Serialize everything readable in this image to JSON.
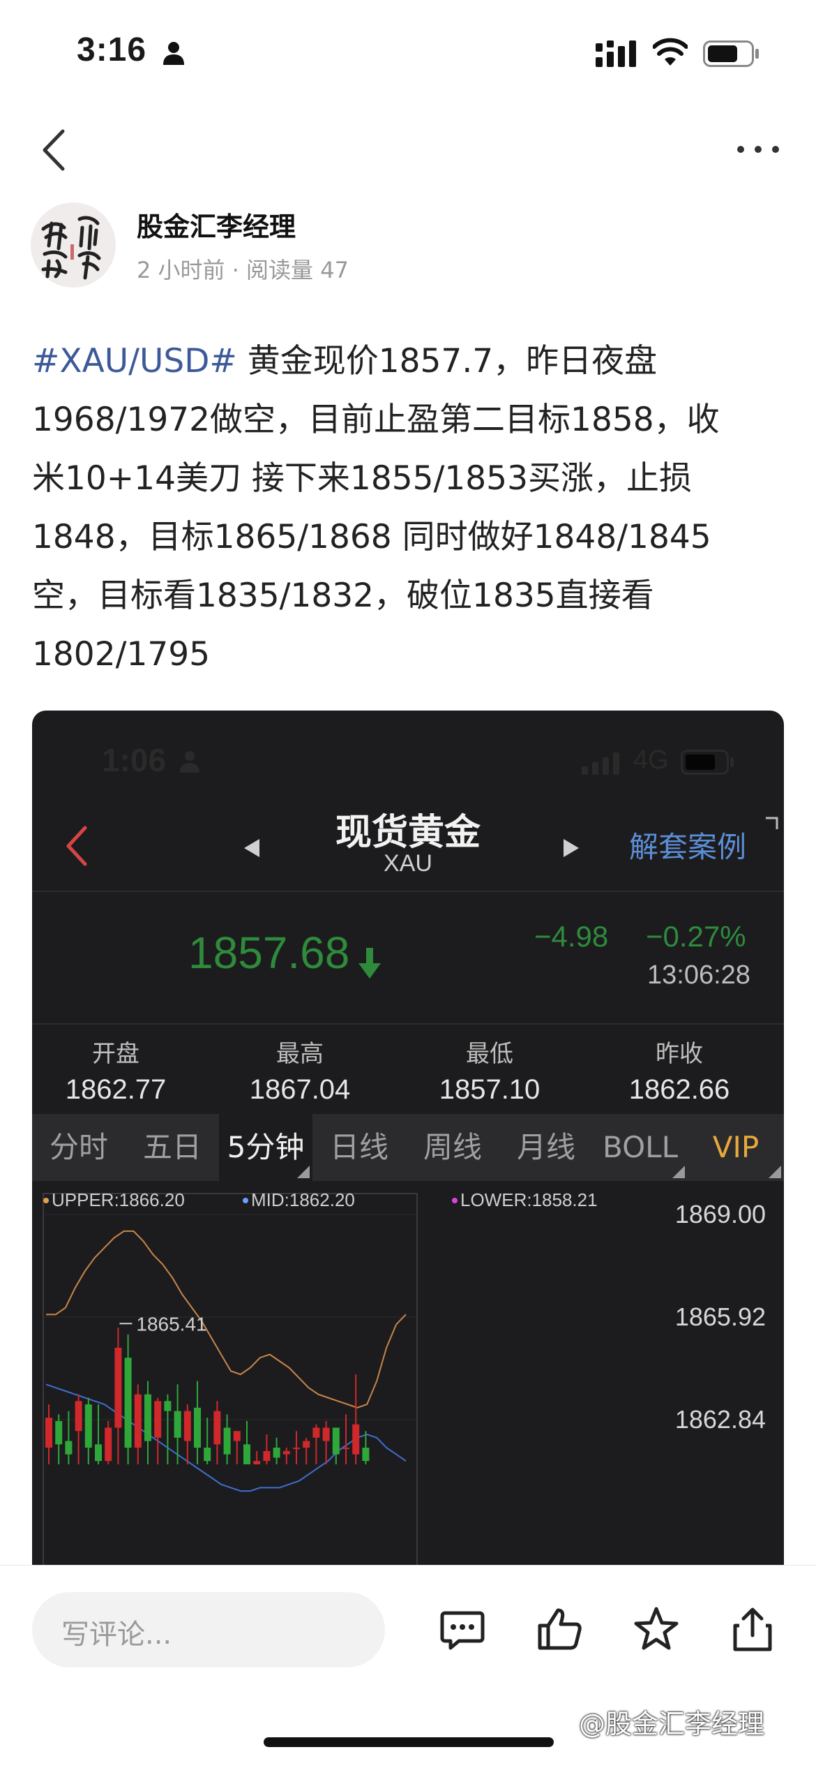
{
  "status_bar": {
    "time": "3:16"
  },
  "post": {
    "author": "股金汇李经理",
    "meta": "2 小时前 · 阅读量 47",
    "tag": "#XAU/USD#",
    "lines": [
      " 黄金现价1857.7，昨日夜盘",
      "1968/1972做空，目前止盈第二目标1858，收",
      "米10+14美刀 接下来1855/1853买涨，止损",
      "1848，目标1865/1868 同时做好1848/1845",
      "空，目标看1835/1832，破位1835直接看",
      "1802/1795"
    ]
  },
  "embedded": {
    "status_time": "1:06",
    "network": "4G",
    "title": "现货黄金",
    "subtitle": "XAU",
    "right_link": "解套案例",
    "price": "1857.68",
    "change": "−4.98",
    "change_pct": "−0.27%",
    "quote_time": "13:06:28",
    "stats": [
      {
        "label": "开盘",
        "value": "1862.77"
      },
      {
        "label": "最高",
        "value": "1867.04"
      },
      {
        "label": "最低",
        "value": "1857.10"
      },
      {
        "label": "昨收",
        "value": "1862.66"
      }
    ],
    "tabs": [
      "分时",
      "五日",
      "5分钟",
      "日线",
      "周线",
      "月线",
      "BOLL",
      "VIP"
    ],
    "active_tab": "5分钟",
    "colors": {
      "up": "#d0282b",
      "down": "#2fa83a",
      "upper": "#c8864a",
      "mid": "#3d6fd0",
      "accent": "#5b8ed6",
      "vip": "#e8a93b"
    }
  },
  "chart_data": {
    "type": "candlestick",
    "indicator_legend": [
      {
        "label": "UPPER:1866.20",
        "color": "#e0a050"
      },
      {
        "label": "MID:1862.20",
        "color": "#6aa0ff"
      },
      {
        "label": "LOWER:1858.21",
        "color": "#e040e0"
      }
    ],
    "y_ticks": [
      "1869.00",
      "1865.92",
      "1862.84"
    ],
    "ylim": [
      1861.5,
      1869.0
    ],
    "annotation": "1865.41",
    "upper_band": [
      1866.0,
      1866.0,
      1866.2,
      1866.8,
      1867.3,
      1867.7,
      1868.0,
      1868.3,
      1868.5,
      1868.5,
      1868.2,
      1867.8,
      1867.5,
      1867.1,
      1866.6,
      1866.2,
      1865.8,
      1865.3,
      1864.8,
      1864.3,
      1864.2,
      1864.4,
      1864.7,
      1864.8,
      1864.6,
      1864.4,
      1864.1,
      1863.8,
      1863.6,
      1863.5,
      1863.4,
      1863.3,
      1863.2,
      1863.3,
      1864.0,
      1865.0,
      1865.7,
      1866.0
    ],
    "mid_band": [
      1863.9,
      1863.8,
      1863.7,
      1863.6,
      1863.5,
      1863.4,
      1863.3,
      1863.1,
      1862.9,
      1862.7,
      1862.5,
      1862.3,
      1862.1,
      1861.9,
      1861.7,
      1861.5,
      1861.3,
      1861.1,
      1860.9,
      1860.8,
      1860.7,
      1860.7,
      1860.8,
      1860.8,
      1860.8,
      1860.9,
      1861.0,
      1861.2,
      1861.4,
      1861.6,
      1861.9,
      1862.1,
      1862.3,
      1862.4,
      1862.3,
      1862.0,
      1861.8,
      1861.6
    ],
    "candles": [
      {
        "o": 1862.0,
        "h": 1863.3,
        "l": 1861.5,
        "c": 1862.9
      },
      {
        "o": 1862.8,
        "h": 1863.0,
        "l": 1861.5,
        "c": 1862.1
      },
      {
        "o": 1862.2,
        "h": 1863.1,
        "l": 1861.5,
        "c": 1861.8
      },
      {
        "o": 1862.5,
        "h": 1863.6,
        "l": 1861.5,
        "c": 1863.4
      },
      {
        "o": 1863.3,
        "h": 1863.5,
        "l": 1861.5,
        "c": 1862.0
      },
      {
        "o": 1862.1,
        "h": 1863.3,
        "l": 1861.5,
        "c": 1861.6
      },
      {
        "o": 1861.6,
        "h": 1862.8,
        "l": 1861.5,
        "c": 1862.6
      },
      {
        "o": 1862.6,
        "h": 1865.6,
        "l": 1861.5,
        "c": 1865.0
      },
      {
        "o": 1864.7,
        "h": 1865.4,
        "l": 1861.5,
        "c": 1862.0
      },
      {
        "o": 1862.0,
        "h": 1863.9,
        "l": 1861.5,
        "c": 1863.6
      },
      {
        "o": 1863.6,
        "h": 1864.0,
        "l": 1861.5,
        "c": 1862.2
      },
      {
        "o": 1862.3,
        "h": 1863.5,
        "l": 1861.5,
        "c": 1863.4
      },
      {
        "o": 1863.4,
        "h": 1863.6,
        "l": 1861.5,
        "c": 1863.1
      },
      {
        "o": 1863.1,
        "h": 1863.9,
        "l": 1861.5,
        "c": 1862.3
      },
      {
        "o": 1862.2,
        "h": 1863.3,
        "l": 1861.5,
        "c": 1863.1
      },
      {
        "o": 1863.2,
        "h": 1864.0,
        "l": 1861.5,
        "c": 1862.0
      },
      {
        "o": 1862.0,
        "h": 1862.9,
        "l": 1861.5,
        "c": 1861.6
      },
      {
        "o": 1862.1,
        "h": 1863.4,
        "l": 1861.5,
        "c": 1863.1
      },
      {
        "o": 1862.6,
        "h": 1863.0,
        "l": 1861.5,
        "c": 1861.8
      },
      {
        "o": 1862.2,
        "h": 1862.5,
        "l": 1861.5,
        "c": 1862.5
      },
      {
        "o": 1862.1,
        "h": 1862.8,
        "l": 1861.5,
        "c": 1861.5
      },
      {
        "o": 1861.5,
        "h": 1861.9,
        "l": 1861.5,
        "c": 1861.6
      },
      {
        "o": 1861.6,
        "h": 1862.4,
        "l": 1861.5,
        "c": 1861.9
      },
      {
        "o": 1862.0,
        "h": 1862.3,
        "l": 1861.5,
        "c": 1861.7
      },
      {
        "o": 1861.8,
        "h": 1862.0,
        "l": 1861.5,
        "c": 1861.9
      },
      {
        "o": 1862.0,
        "h": 1862.5,
        "l": 1861.5,
        "c": 1862.0
      },
      {
        "o": 1862.0,
        "h": 1862.3,
        "l": 1861.5,
        "c": 1862.2
      },
      {
        "o": 1862.3,
        "h": 1862.7,
        "l": 1861.5,
        "c": 1862.6
      },
      {
        "o": 1862.2,
        "h": 1862.8,
        "l": 1861.5,
        "c": 1862.6
      },
      {
        "o": 1862.6,
        "h": 1862.6,
        "l": 1861.5,
        "c": 1861.8
      },
      {
        "o": 1862.0,
        "h": 1863.0,
        "l": 1861.5,
        "c": 1862.0
      },
      {
        "o": 1861.8,
        "h": 1864.2,
        "l": 1861.5,
        "c": 1862.7
      },
      {
        "o": 1862.0,
        "h": 1862.5,
        "l": 1861.5,
        "c": 1861.6
      }
    ]
  },
  "bottom_bar": {
    "comment_placeholder": "写评论...",
    "watermark": "@股金汇李经理"
  }
}
